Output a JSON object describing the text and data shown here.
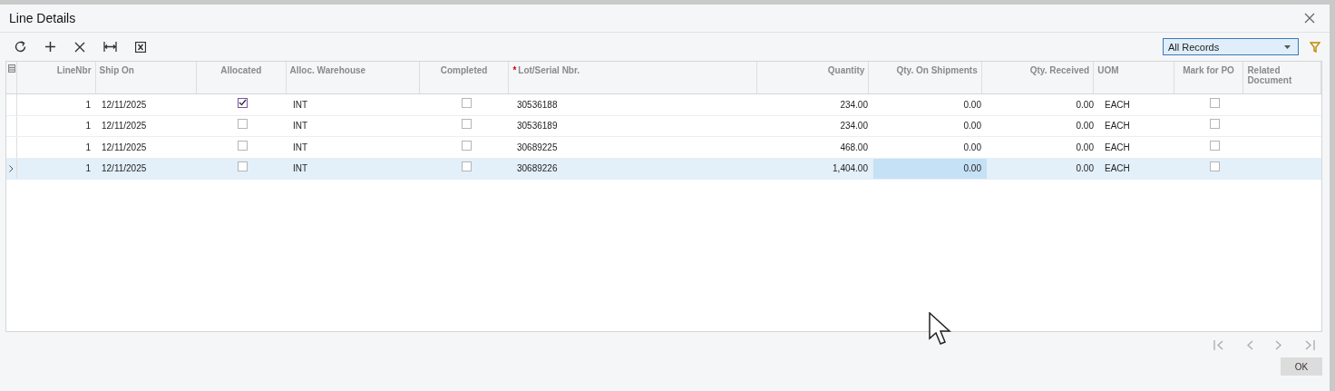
{
  "dialog": {
    "title": "Line Details"
  },
  "filter": {
    "value": "All Records"
  },
  "table": {
    "columns": [
      {
        "label": "LineNbr",
        "kind": "text"
      },
      {
        "label": "Ship On",
        "kind": "text"
      },
      {
        "label": "Allocated",
        "kind": "check"
      },
      {
        "label": "Alloc. Warehouse",
        "kind": "text"
      },
      {
        "label": "Completed",
        "kind": "check"
      },
      {
        "label": "Lot/Serial Nbr.",
        "kind": "text",
        "required_mark": "*"
      },
      {
        "label": "Quantity",
        "kind": "text"
      },
      {
        "label": "Qty. On Shipments",
        "kind": "text"
      },
      {
        "label": "Qty. Received",
        "kind": "text"
      },
      {
        "label": "UOM",
        "kind": "text"
      },
      {
        "label": "Mark for PO",
        "kind": "check"
      },
      {
        "label": "Related Document",
        "kind": "text"
      }
    ],
    "rows": [
      {
        "selected": false,
        "cells": [
          {
            "text": "1",
            "focused": false
          },
          {
            "text": "12/11/2025",
            "focused": false
          },
          {
            "checked": true,
            "focused": false
          },
          {
            "text": "INT",
            "focused": false
          },
          {
            "checked": false,
            "focused": false
          },
          {
            "text": "30536188",
            "focused": false
          },
          {
            "text": "234.00",
            "focused": false
          },
          {
            "text": "0.00",
            "focused": false
          },
          {
            "text": "0.00",
            "focused": false
          },
          {
            "text": "EACH",
            "focused": false
          },
          {
            "checked": false,
            "focused": false
          },
          {
            "focused": false
          }
        ]
      },
      {
        "selected": false,
        "cells": [
          {
            "text": "1",
            "focused": false
          },
          {
            "text": "12/11/2025",
            "focused": false
          },
          {
            "checked": false,
            "focused": false
          },
          {
            "text": "INT",
            "focused": false
          },
          {
            "checked": false,
            "focused": false
          },
          {
            "text": "30536189",
            "focused": false
          },
          {
            "text": "234.00",
            "focused": false
          },
          {
            "text": "0.00",
            "focused": false
          },
          {
            "text": "0.00",
            "focused": false
          },
          {
            "text": "EACH",
            "focused": false
          },
          {
            "checked": false,
            "focused": false
          },
          {
            "focused": false
          }
        ]
      },
      {
        "selected": false,
        "cells": [
          {
            "text": "1",
            "focused": false
          },
          {
            "text": "12/11/2025",
            "focused": false
          },
          {
            "checked": false,
            "focused": false
          },
          {
            "text": "INT",
            "focused": false
          },
          {
            "checked": false,
            "focused": false
          },
          {
            "text": "30689225",
            "focused": false
          },
          {
            "text": "468.00",
            "focused": false
          },
          {
            "text": "0.00",
            "focused": false
          },
          {
            "text": "0.00",
            "focused": false
          },
          {
            "text": "EACH",
            "focused": false
          },
          {
            "checked": false,
            "focused": false
          },
          {
            "focused": false
          }
        ]
      },
      {
        "selected": true,
        "cells": [
          {
            "text": "1",
            "focused": false
          },
          {
            "text": "12/11/2025",
            "focused": false
          },
          {
            "checked": false,
            "focused": false
          },
          {
            "text": "INT",
            "focused": false
          },
          {
            "checked": false,
            "focused": false
          },
          {
            "text": "30689226",
            "focused": false
          },
          {
            "text": "1,404.00",
            "focused": false
          },
          {
            "text": "0.00",
            "focused": true
          },
          {
            "text": "0.00",
            "focused": false
          },
          {
            "text": "EACH",
            "focused": false
          },
          {
            "checked": false,
            "focused": false
          },
          {
            "focused": false
          }
        ]
      }
    ]
  },
  "buttons": [
    {
      "label": "OK"
    }
  ]
}
